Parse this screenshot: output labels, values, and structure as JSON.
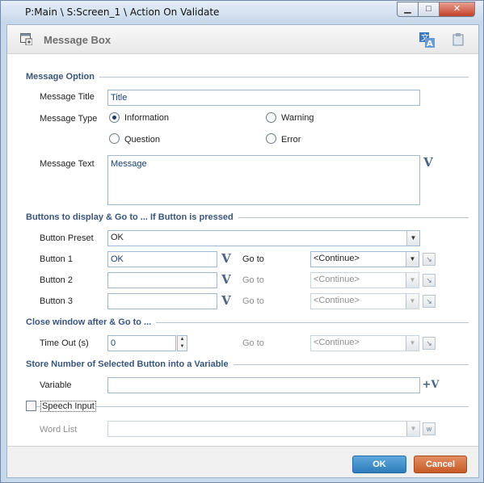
{
  "window": {
    "title": "P:Main \\ S:Screen_1 \\ Action On Validate",
    "minimize": "▁",
    "maximize": "□",
    "close": "✕"
  },
  "header": {
    "title": "Message Box",
    "icons": [
      "dialog-icon",
      "translate-icon",
      "notes-icon"
    ]
  },
  "message_option": {
    "section": "Message Option",
    "title_label": "Message Title",
    "title_value": "Title",
    "type_label": "Message Type",
    "types": [
      {
        "label": "Information",
        "selected": true
      },
      {
        "label": "Warning",
        "selected": false
      },
      {
        "label": "Question",
        "selected": false
      },
      {
        "label": "Error",
        "selected": false
      }
    ],
    "text_label": "Message Text",
    "text_value": "Message"
  },
  "buttons": {
    "section": "Buttons to display & Go to ... If Button is pressed",
    "preset_label": "Button Preset",
    "preset_value": "OK",
    "rows": [
      {
        "label": "Button 1",
        "value": "OK",
        "goto_label": "Go to",
        "goto_value": "<Continue>",
        "enabled": true
      },
      {
        "label": "Button 2",
        "value": "",
        "goto_label": "Go to",
        "goto_value": "<Continue>",
        "enabled": false
      },
      {
        "label": "Button 3",
        "value": "",
        "goto_label": "Go to",
        "goto_value": "<Continue>",
        "enabled": false
      }
    ],
    "var_glyph": "V"
  },
  "close_window": {
    "section": "Close window after & Go to ...",
    "timeout_label": "Time Out (s)",
    "timeout_value": "0",
    "goto_label": "Go to",
    "goto_value": "<Continue>"
  },
  "store": {
    "section": "Store Number of Selected Button into a Variable",
    "variable_label": "Variable",
    "variable_value": "",
    "add_var_glyph": "+V"
  },
  "speech": {
    "checkbox_label": "Speech Input",
    "checked": false,
    "wordlist_label": "Word List",
    "wordlist_value": ""
  },
  "footer": {
    "ok": "OK",
    "cancel": "Cancel"
  }
}
